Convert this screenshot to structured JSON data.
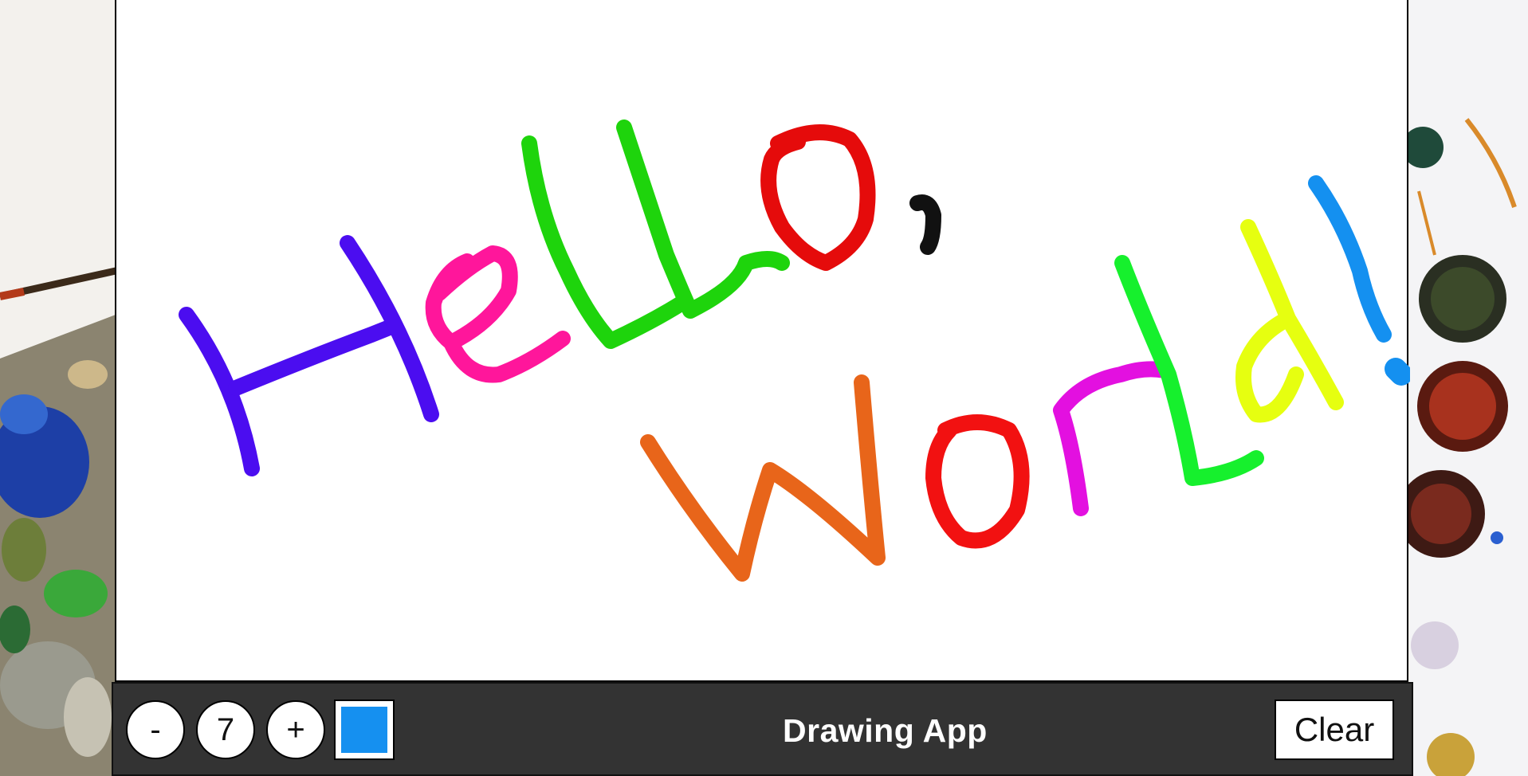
{
  "app": {
    "title": "Drawing App"
  },
  "toolbar": {
    "decrease_label": "-",
    "size_value": "7",
    "increase_label": "+",
    "current_color": "#1590f0",
    "clear_label": "Clear"
  },
  "drawing": {
    "content": "Hello, World!",
    "stroke_colors": [
      "#4b0df0",
      "#ff169b",
      "#1ed40c",
      "#e50b0b",
      "#111111",
      "#e8651a",
      "#f21111",
      "#e310e0",
      "#16f02d",
      "#e6ff10",
      "#1490f0"
    ]
  },
  "colors": {
    "toolbar_bg": "#333333",
    "canvas_bg": "#ffffff"
  }
}
